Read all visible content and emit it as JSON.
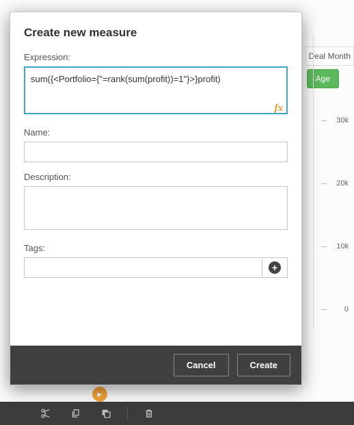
{
  "background": {
    "deal_month_label": "Deal Month",
    "age_button": "Age",
    "axis_ticks": [
      "30k",
      "20k",
      "10k",
      "0"
    ]
  },
  "modal": {
    "title": "Create new measure",
    "expression_label": "Expression:",
    "expression_value": "sum({<Portfolio={\"=rank(sum(profit))=1\"}>}profit)",
    "fx_label": "fx",
    "name_label": "Name:",
    "name_value": "",
    "description_label": "Description:",
    "description_value": "",
    "tags_label": "Tags:",
    "tags_value": "",
    "cancel": "Cancel",
    "create": "Create"
  },
  "toolbar": {
    "cut": "cut",
    "copy": "copy",
    "paste": "paste",
    "delete": "delete"
  }
}
